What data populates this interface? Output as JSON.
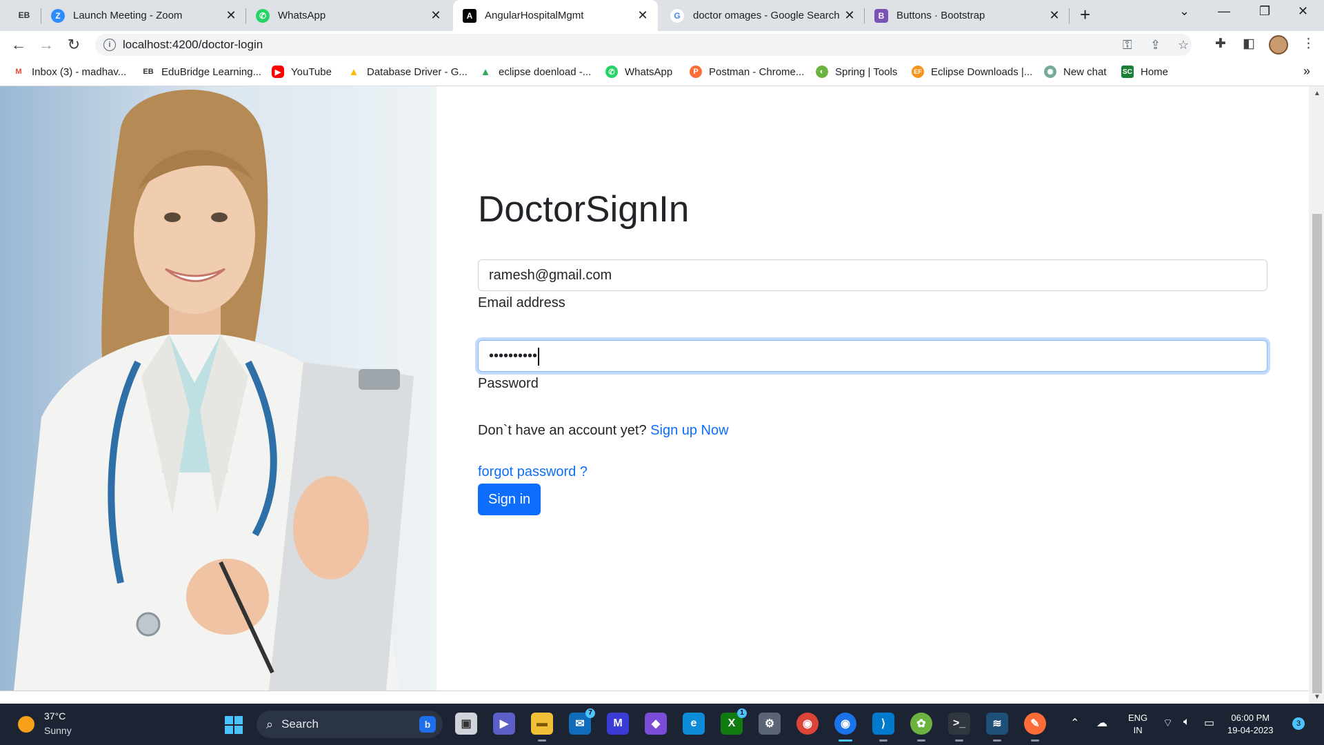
{
  "browser": {
    "tabs": [
      {
        "title": "Launch Meeting - Zoom",
        "icon": "zoom-icon"
      },
      {
        "title": "WhatsApp",
        "icon": "whatsapp-icon"
      },
      {
        "title": "AngularHospitalMgmt",
        "icon": "angular-icon"
      },
      {
        "title": "doctor omages - Google Search",
        "icon": "google-icon"
      },
      {
        "title": "Buttons · Bootstrap",
        "icon": "bootstrap-icon"
      }
    ],
    "active_tab": "AngularHospitalMgmt",
    "url": "localhost:4200/doctor-login",
    "bookmarks": [
      {
        "label": "Inbox (3) - madhav...",
        "icon": "gmail-icon"
      },
      {
        "label": "EduBridge Learning...",
        "icon": "edubridge-icon"
      },
      {
        "label": "YouTube",
        "icon": "youtube-icon"
      },
      {
        "label": "Database Driver - G...",
        "icon": "drive-icon"
      },
      {
        "label": "eclipse doenload -...",
        "icon": "drive-icon"
      },
      {
        "label": "WhatsApp",
        "icon": "whatsapp-icon"
      },
      {
        "label": "Postman - Chrome...",
        "icon": "postman-icon"
      },
      {
        "label": "Spring | Tools",
        "icon": "spring-icon"
      },
      {
        "label": "Eclipse Downloads |...",
        "icon": "eclipse-icon"
      },
      {
        "label": "New chat",
        "icon": "chatgpt-icon"
      },
      {
        "label": "Home",
        "icon": "sc-icon"
      }
    ]
  },
  "page": {
    "title": "DoctorSignIn",
    "email_value": "ramesh@gmail.com",
    "email_label": "Email address",
    "password_value": "••••••••••",
    "password_label": "Password",
    "signup_prompt": "Don`t have an account yet?",
    "signup_link": "Sign up Now",
    "forgot_link": "forgot password ?",
    "signin_button": "Sign in",
    "primary_color": "#0d6efd"
  },
  "taskbar": {
    "weather_temp": "37°C",
    "weather_desc": "Sunny",
    "search_placeholder": "Search",
    "mail_badge": "7",
    "xbox_badge": "1",
    "lang_1": "ENG",
    "lang_2": "IN",
    "time": "06:00 PM",
    "date": "19-04-2023",
    "notifications": "3"
  }
}
